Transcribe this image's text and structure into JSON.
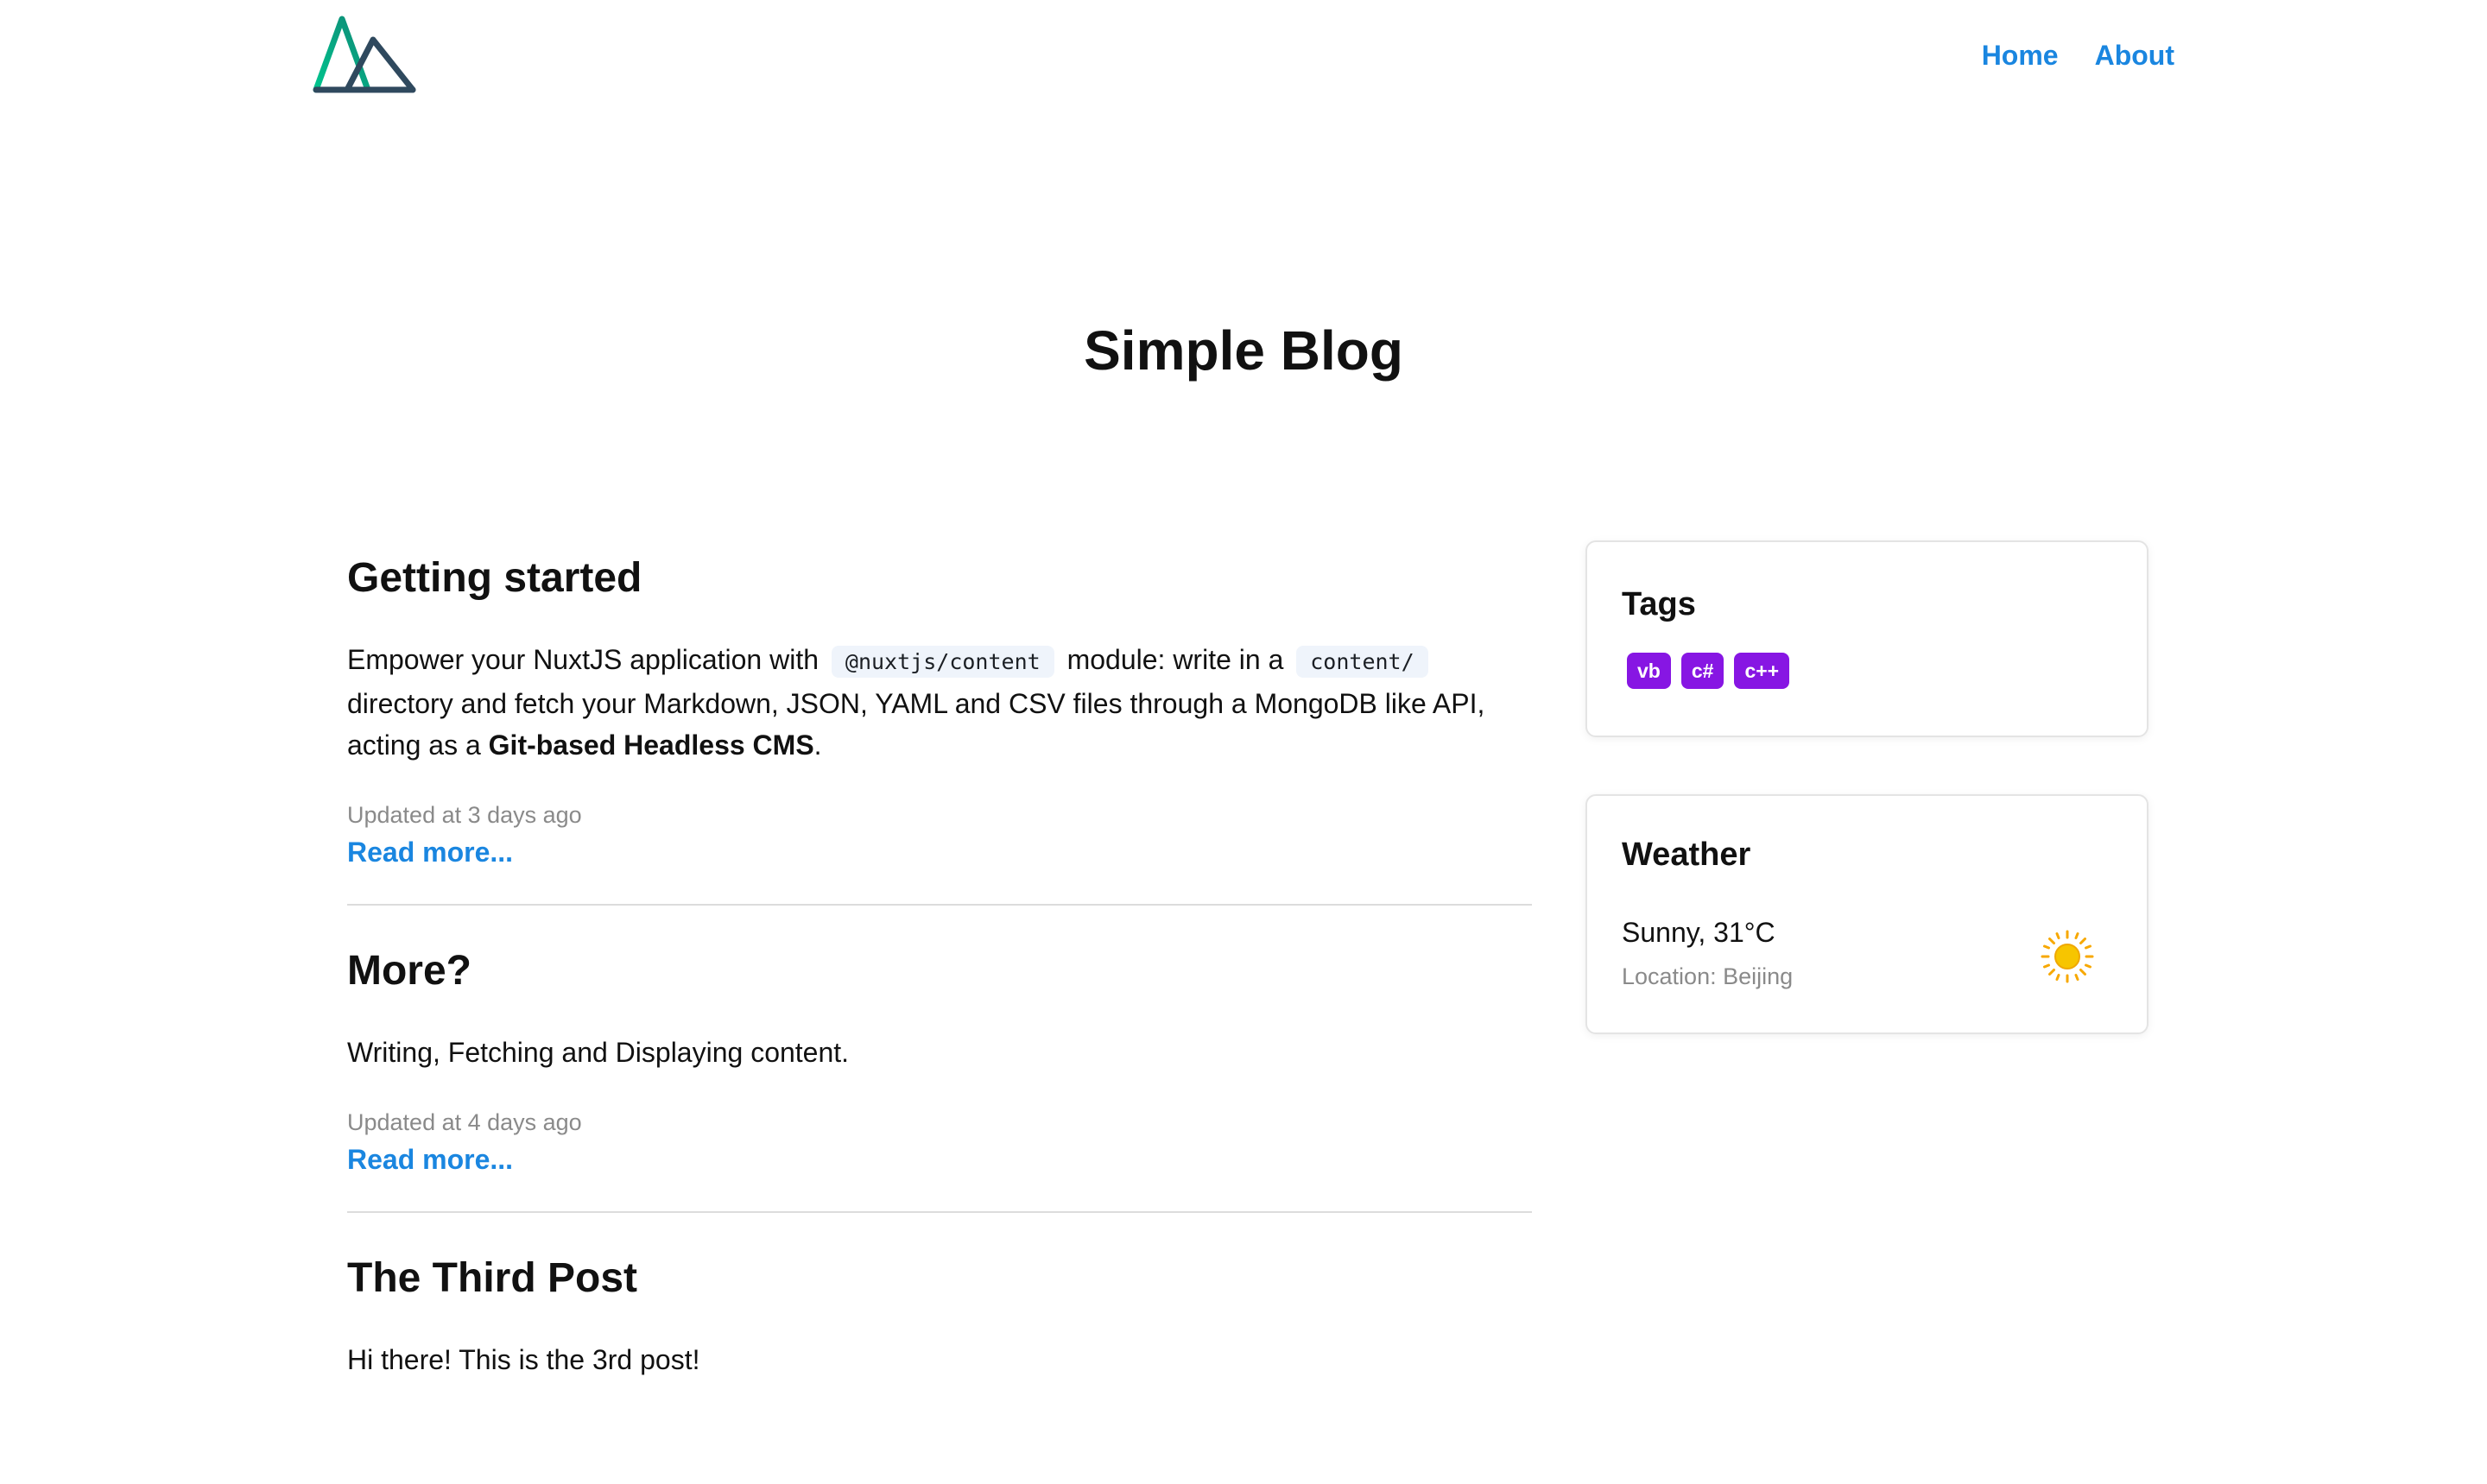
{
  "nav": {
    "home": "Home",
    "about": "About"
  },
  "page_title": "Simple Blog",
  "posts": [
    {
      "title": "Getting started",
      "desc_part1": "Empower your NuxtJS application with",
      "code1": "@nuxtjs/content",
      "desc_part2": "module: write in a",
      "code2": "content/",
      "desc_part3": "directory and fetch your Markdown, JSON, YAML and CSV files through a MongoDB like API, acting as a",
      "desc_bold": "Git-based Headless CMS",
      "desc_end": ".",
      "updated": "Updated at 3 days ago",
      "read_more": "Read more..."
    },
    {
      "title": "More?",
      "desc": "Writing, Fetching and Displaying content.",
      "updated": "Updated at 4 days ago",
      "read_more": "Read more..."
    },
    {
      "title": "The Third Post",
      "desc": "Hi there! This is the 3rd post!"
    }
  ],
  "sidebar": {
    "tags": {
      "title": "Tags",
      "items": [
        "vb",
        "c#",
        "c++"
      ]
    },
    "weather": {
      "title": "Weather",
      "condition": "Sunny, 31°C",
      "location": "Location: Beijing",
      "icon": "sun-icon"
    }
  },
  "colors": {
    "link": "#1a86e0",
    "tag": "#8716e3",
    "logo_green": "#00c58e",
    "logo_dark": "#2f495e",
    "sun": "#f7c500"
  }
}
